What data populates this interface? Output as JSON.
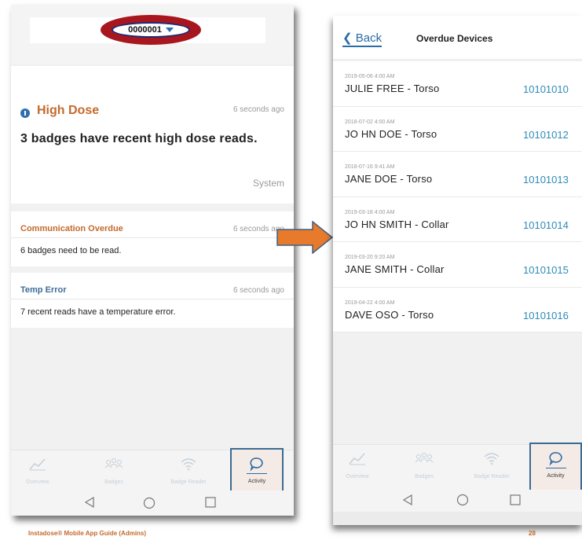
{
  "left_phone": {
    "device_selector": {
      "value": "0000001"
    },
    "high_dose": {
      "title": "High Dose",
      "time": "6 seconds ago",
      "message": "3 badges have recent high dose reads.",
      "source": "System"
    },
    "communication_overdue": {
      "title": "Communication Overdue",
      "time": "6 seconds ago",
      "message": "6 badges need to be read.",
      "title_color": "#c46a2c"
    },
    "temp_error": {
      "title": "Temp Error",
      "time": "6 seconds ago",
      "message": "7 recent reads have a temperature error.",
      "title_color": "#3f6d97"
    },
    "tabs": [
      {
        "label": "Overview",
        "icon": "trend-line-icon"
      },
      {
        "label": "Badges",
        "icon": "people-group-icon"
      },
      {
        "label": "Badge Reader",
        "icon": "wifi-icon"
      },
      {
        "label": "Activity",
        "icon": "speech-bubble-icon",
        "active": true
      }
    ]
  },
  "right_phone": {
    "back_label": "Back",
    "title": "Overdue Devices",
    "devices": [
      {
        "date": "2019-05-06 4:00 AM",
        "name": "JULIE FREE - Torso",
        "serial": "10101010"
      },
      {
        "date": "2018-07-02 4:00 AM",
        "name": "JO HN DOE - Torso",
        "serial": "10101012"
      },
      {
        "date": "2018-07-16 9:41 AM",
        "name": "JANE DOE - Torso",
        "serial": "10101013"
      },
      {
        "date": "2019-03-18 4:00 AM",
        "name": "JO HN SMITH - Collar",
        "serial": "10101014"
      },
      {
        "date": "2019-03-20 9:20 AM",
        "name": "JANE SMITH - Collar",
        "serial": "10101015"
      },
      {
        "date": "2019-04-22 4:00 AM",
        "name": "DAVE OSO - Torso",
        "serial": "10101016"
      }
    ],
    "tabs": [
      {
        "label": "Overview",
        "icon": "trend-line-icon"
      },
      {
        "label": "Badges",
        "icon": "people-group-icon"
      },
      {
        "label": "Badge Reader",
        "icon": "wifi-icon"
      },
      {
        "label": "Activity",
        "icon": "speech-bubble-icon",
        "active": true
      }
    ]
  },
  "footer": {
    "guide_title": "Instadose® Mobile App Guide (Admins)",
    "page_number": "28"
  },
  "colors": {
    "accent_orange": "#c46a2c",
    "link_blue": "#2a6ca6",
    "serial_blue": "#2e8bb8",
    "highlight_red": "#a8161e",
    "arrow_orange": "#e87a2c"
  }
}
